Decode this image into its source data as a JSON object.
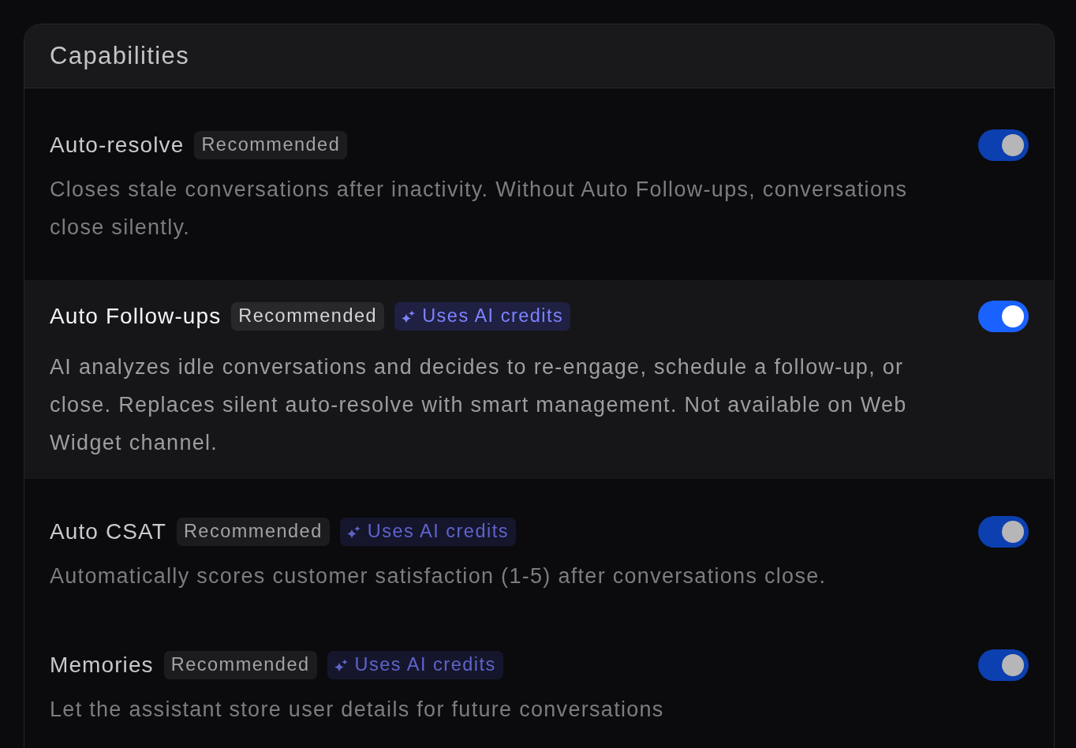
{
  "card": {
    "title": "Capabilities"
  },
  "capabilities": [
    {
      "name": "Auto-resolve",
      "badges": [
        {
          "kind": "recommended",
          "label": "Recommended"
        }
      ],
      "description": "Closes stale conversations after inactivity. Without Auto Follow-ups, conversations close silently.",
      "on": true,
      "hovered": false
    },
    {
      "name": "Auto Follow-ups",
      "badges": [
        {
          "kind": "recommended",
          "label": "Recommended"
        },
        {
          "kind": "ai_credits",
          "label": "Uses AI credits"
        }
      ],
      "description": "AI analyzes idle conversations and decides to re-engage, schedule a follow-up, or close. Replaces silent auto-resolve with smart management. Not available on Web Widget channel.",
      "on": true,
      "hovered": true
    },
    {
      "name": "Auto CSAT",
      "badges": [
        {
          "kind": "recommended",
          "label": "Recommended"
        },
        {
          "kind": "ai_credits",
          "label": "Uses AI credits"
        }
      ],
      "description": "Automatically scores customer satisfaction (1-5) after conversations close.",
      "on": true,
      "hovered": false
    },
    {
      "name": "Memories",
      "badges": [
        {
          "kind": "recommended",
          "label": "Recommended"
        },
        {
          "kind": "ai_credits",
          "label": "Uses AI credits"
        }
      ],
      "description": "Let the assistant store user details for future conversations",
      "on": true,
      "hovered": false
    }
  ]
}
